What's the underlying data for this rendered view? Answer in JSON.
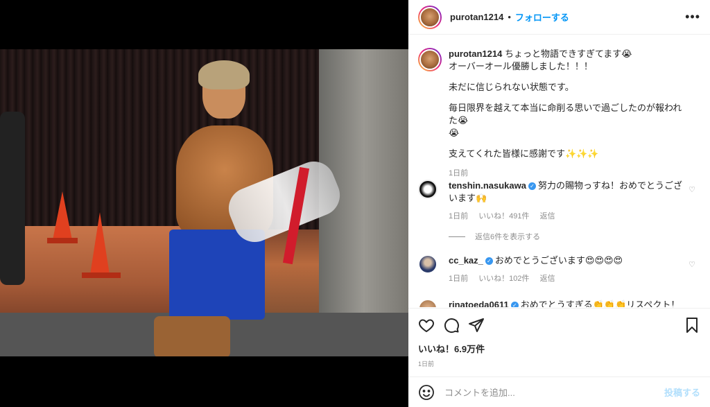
{
  "post": {
    "username": "purotan1214",
    "follow_label": "フォローする",
    "more_icon": "•••",
    "caption_lines": [
      "ちょっと物語できすぎてます😭",
      "オーバーオール優勝しました！！！",
      "",
      "未だに信じられない状態です。",
      "",
      "毎日限界を越えて本当に命削る思いで過ごしたのが報われた😭",
      "😭",
      "",
      "支えてくれた皆様に感謝です✨✨✨"
    ],
    "caption_time": "1日前"
  },
  "comments": [
    {
      "username": "tenshin.nasukawa",
      "text": "努力の賜物っすね！おめでとうございます🙌",
      "time": "1日前",
      "likes": "いいね！491件",
      "reply": "返信",
      "view_replies": "返信6件を表示する"
    },
    {
      "username": "cc_kaz_",
      "text": "おめでとうございます😍😍😍😍",
      "time": "1日前",
      "likes": "いいね！102件",
      "reply": "返信"
    },
    {
      "username": "rinatoeda0611",
      "text": "おめでとうすぎる👏👏👏リスペクト！✨"
    }
  ],
  "footer": {
    "likes": "いいね！6.9万件",
    "time": "1日前",
    "comment_placeholder": "コメントを追加...",
    "post_label": "投稿する"
  },
  "colors": {
    "link_blue": "#0095f6",
    "muted": "#8e8e8e",
    "border": "#efefef"
  }
}
